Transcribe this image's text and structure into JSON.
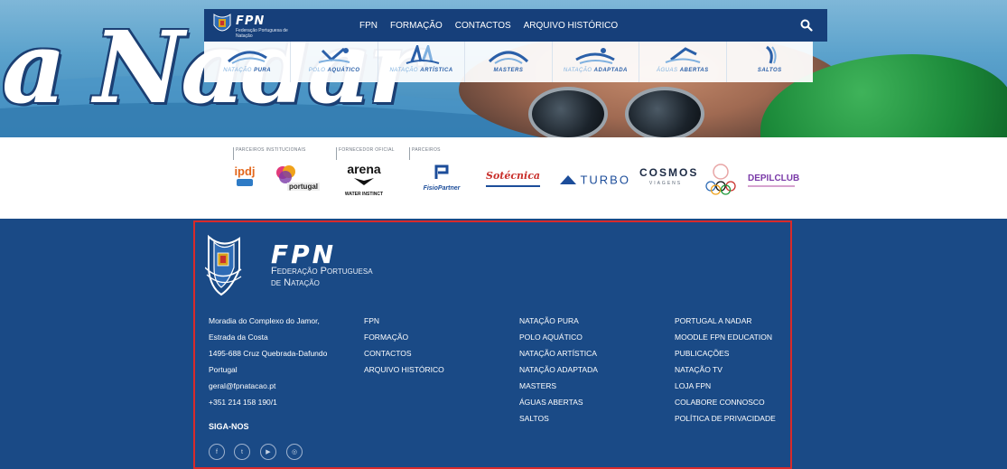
{
  "nav": {
    "logo_text": "FPN",
    "logo_subtitle": "Federação Portuguesa de Natação",
    "links": [
      "FPN",
      "FORMAÇÃO",
      "CONTACTOS",
      "ARQUIVO HISTÓRICO"
    ]
  },
  "hero": {
    "script_text": "a Nadar"
  },
  "disciplines": [
    {
      "light": "NATAÇÃO",
      "bold": "PURA"
    },
    {
      "light": "POLO",
      "bold": "AQUÁTICO"
    },
    {
      "light": "NATAÇÃO",
      "bold": "ARTÍSTICA"
    },
    {
      "light": "",
      "bold": "MASTERS"
    },
    {
      "light": "NATAÇÃO",
      "bold": "ADAPTADA"
    },
    {
      "light": "ÁGUAS",
      "bold": "ABERTAS"
    },
    {
      "light": "",
      "bold": "SALTOS"
    }
  ],
  "partners": {
    "headings": {
      "institutional": "PARCEIROS INSTITUCIONAIS",
      "supplier": "FORNECEDOR OFICIAL",
      "partners": "PARCEIROS"
    },
    "logos": {
      "ipdj": "ipdj",
      "portugal": "portugal",
      "arena": "arena",
      "arena_sub": "WATER INSTINCT",
      "fisio": "FisioPartner",
      "sotecnica": "Sotécnica",
      "turbo": "TURBO",
      "cosmos": "COSMOS",
      "cosmos_sub": "VIAGENS",
      "depil": "DEPILCLUB"
    }
  },
  "footer": {
    "logo_fpn": "FPN",
    "org_line1": "Federação Portuguesa",
    "org_line2": "de Natação",
    "address": [
      "Moradia do Complexo do Jamor,",
      "Estrada da Costa",
      "1495-688 Cruz Quebrada-Dafundo",
      "Portugal",
      "geral@fpnatacao.pt",
      "+351 214 158 190/1"
    ],
    "col2": [
      "FPN",
      "FORMAÇÃO",
      "CONTACTOS",
      "ARQUIVO HISTÓRICO"
    ],
    "col3": [
      "NATAÇÃO PURA",
      "POLO AQUÁTICO",
      "NATAÇÃO ARTÍSTICA",
      "NATAÇÃO ADAPTADA",
      "MASTERS",
      "ÁGUAS ABERTAS",
      "SALTOS"
    ],
    "col4": [
      "PORTUGAL A NADAR",
      "MOODLE FPN EDUCATION",
      "PUBLICAÇÕES",
      "NATAÇÃO TV",
      "LOJA FPN",
      "COLABORE CONNOSCO",
      "POLÍTICA DE PRIVACIDADE"
    ],
    "siga": "SIGA-NOS",
    "social": [
      {
        "icon": "facebook-icon",
        "glyph": "f"
      },
      {
        "icon": "twitter-icon",
        "glyph": "t"
      },
      {
        "icon": "youtube-icon",
        "glyph": "▶"
      },
      {
        "icon": "instagram-icon",
        "glyph": "◎"
      }
    ]
  },
  "colors": {
    "nav_bg": "#163f7a",
    "footer_bg": "#1a4a86",
    "highlight": "#d92a2a",
    "discipline_blue": "#2a5fa8"
  }
}
